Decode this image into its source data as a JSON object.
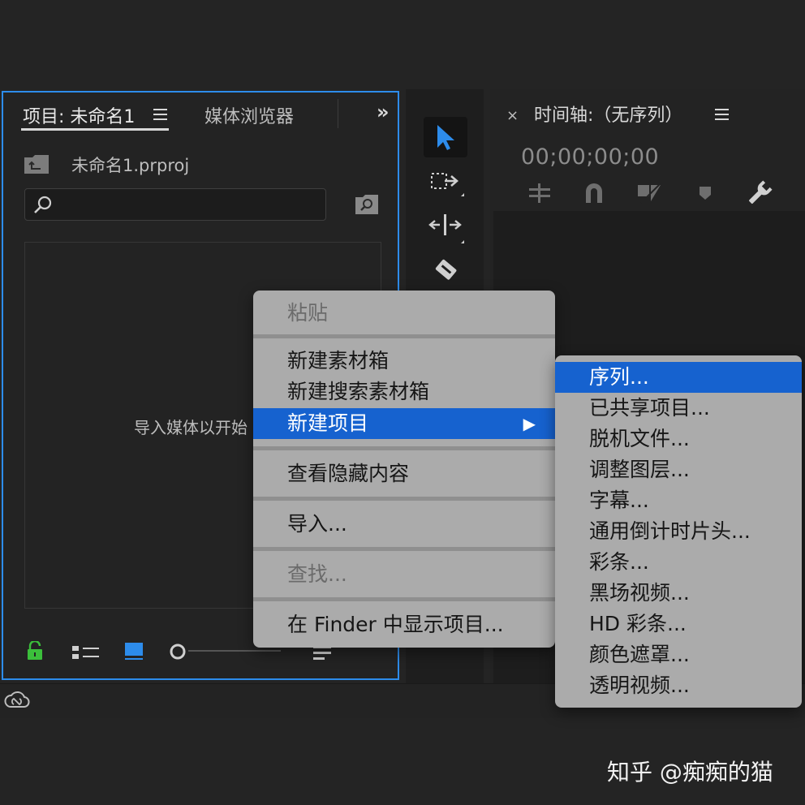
{
  "project_panel": {
    "tab_project": "项目: 未命名1",
    "tab_media": "媒体浏览器",
    "project_file": "未命名1.prproj",
    "search": {
      "value": "",
      "placeholder": ""
    },
    "empty_text": "导入媒体以开始"
  },
  "timeline": {
    "title": "时间轴:（无序列）",
    "timecode": "00;00;00;00"
  },
  "context_menu": {
    "paste": "粘贴",
    "new_bin": "新建素材箱",
    "new_search_bin": "新建搜索素材箱",
    "new_item": "新建项目",
    "view_hidden": "查看隐藏内容",
    "import": "导入...",
    "find": "查找...",
    "reveal_finder": "在 Finder 中显示项目..."
  },
  "submenu": {
    "items": [
      "序列...",
      "已共享项目...",
      "脱机文件...",
      "调整图层...",
      "字幕...",
      "通用倒计时片头...",
      "彩条...",
      "黑场视频...",
      "HD 彩条...",
      "颜色遮罩...",
      "透明视频..."
    ]
  },
  "watermark": "知乎 @痴痴的猫",
  "colors": {
    "accent": "#2d8ceb",
    "highlight": "#1662cf",
    "lock_green": "#3bbf3b"
  }
}
